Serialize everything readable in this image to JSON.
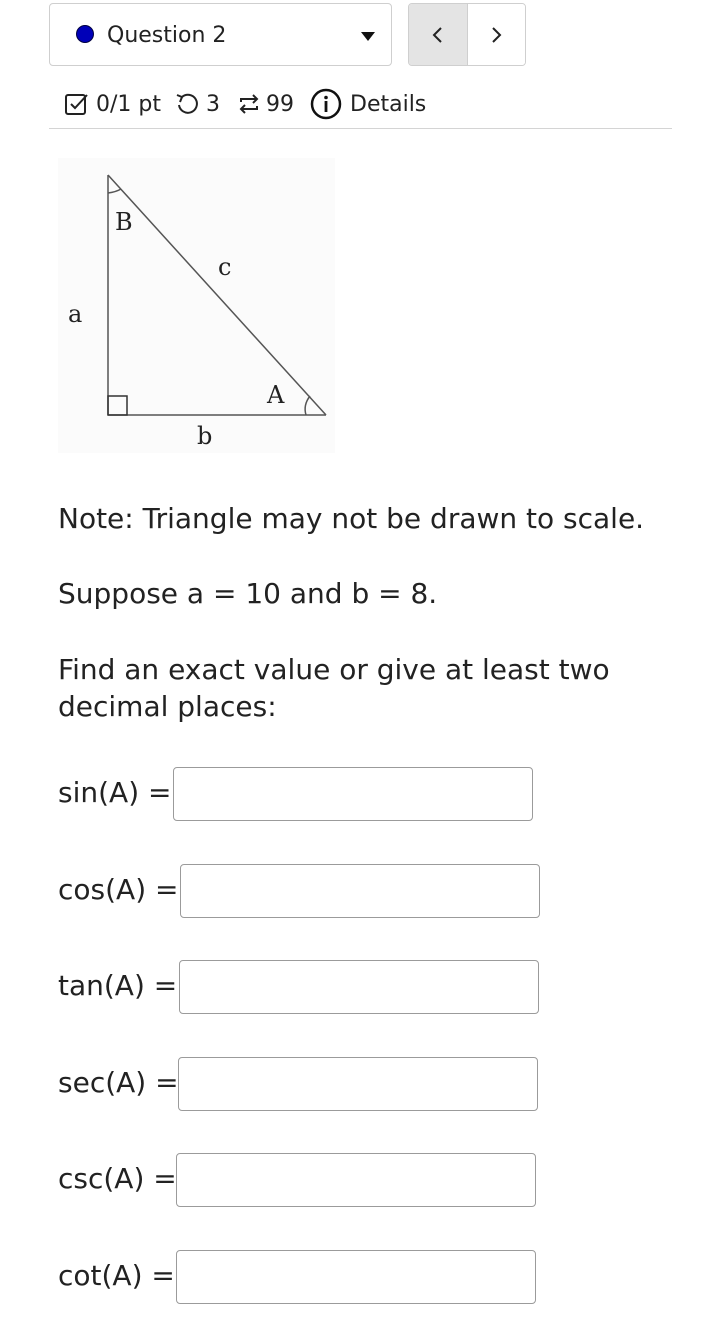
{
  "question_selector": {
    "label": "Question 2",
    "status_color": "#0000b8"
  },
  "nav": {
    "prev_icon": "chevron-left-icon",
    "next_icon": "chevron-right-icon"
  },
  "meta": {
    "score": "0/1 pt",
    "attempts": "3",
    "versions": "99",
    "details": "Details"
  },
  "figure": {
    "vertex_b": "B",
    "vertex_a": "A",
    "side_c": "c",
    "side_a": "a",
    "side_b": "b"
  },
  "problem": {
    "note": "Note: Triangle may not be drawn to scale.",
    "given": "Suppose a = 10 and b = 8.",
    "instruction": "Find an exact value or give at least two decimal places:"
  },
  "answers": [
    {
      "label": "sin(A) =",
      "value": ""
    },
    {
      "label": "cos(A) =",
      "value": ""
    },
    {
      "label": "tan(A) =",
      "value": ""
    },
    {
      "label": "sec(A) =",
      "value": ""
    },
    {
      "label": "csc(A) =",
      "value": ""
    },
    {
      "label": "cot(A) =",
      "value": ""
    }
  ]
}
